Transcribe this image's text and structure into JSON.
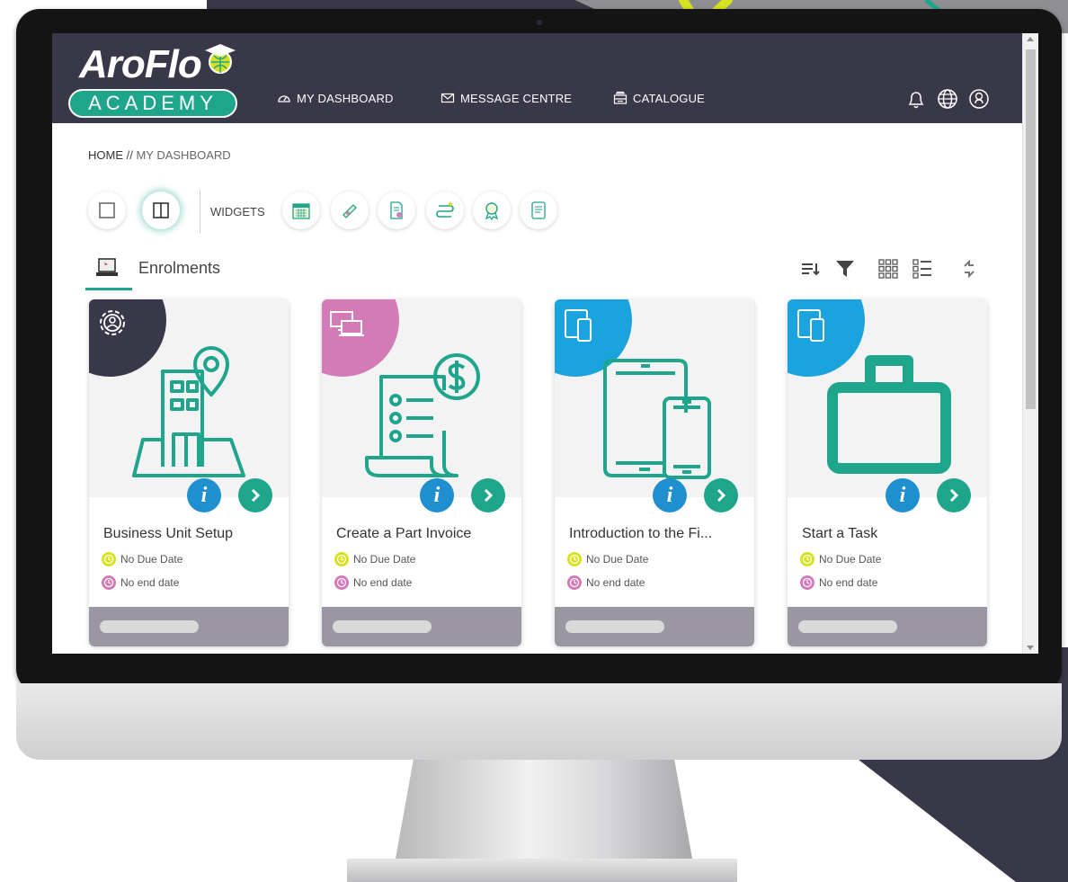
{
  "colors": {
    "topbar": "#393849",
    "brand_green": "#1fa58b",
    "info_blue": "#1f8fd0",
    "corner_dark": "#393849",
    "corner_pink": "#d37bb7",
    "corner_blue": "#1aa3dc",
    "due_yellow": "#d6e21f",
    "end_pink": "#d37bb7",
    "footer_grey": "#9b97a2"
  },
  "header": {
    "logo_text": "AroFlo",
    "logo_sub": "ACADEMY",
    "nav": [
      {
        "label": "MY DASHBOARD",
        "icon": "gauge-icon"
      },
      {
        "label": "MESSAGE CENTRE",
        "icon": "envelope-icon"
      },
      {
        "label": "CATALOGUE",
        "icon": "catalogue-icon"
      }
    ],
    "icons": [
      "bell-icon",
      "globe-icon",
      "user-icon"
    ]
  },
  "breadcrumb": {
    "home": "HOME",
    "separator": " // ",
    "current": "MY DASHBOARD"
  },
  "toolbar": {
    "layout_buttons": [
      "single-column-icon",
      "two-column-icon"
    ],
    "widgets_label": "WIDGETS",
    "widgets": [
      "calendar-icon",
      "certificate-icon",
      "document-icon",
      "pathway-icon",
      "badge-icon",
      "report-icon"
    ]
  },
  "section": {
    "title": "Enrolments",
    "tools": [
      "sort-icon",
      "filter-icon",
      "grid-view-icon",
      "list-view-icon",
      "refresh-icon"
    ]
  },
  "cards": [
    {
      "title": "Business Unit Setup",
      "due": "No Due Date",
      "end": "No end date",
      "corner": "settings-user-icon",
      "art": "building-location-icon"
    },
    {
      "title": "Create a Part Invoice",
      "due": "No Due Date",
      "end": "No end date",
      "corner": "devices-icon",
      "art": "invoice-icon"
    },
    {
      "title": "Introduction to the Fi...",
      "due": "No Due Date",
      "end": "No end date",
      "corner": "tablet-phone-icon",
      "art": "tablet-phone-icon"
    },
    {
      "title": "Start a Task",
      "due": "No Due Date",
      "end": "No end date",
      "corner": "tablet-phone-icon",
      "art": "briefcase-icon"
    }
  ]
}
